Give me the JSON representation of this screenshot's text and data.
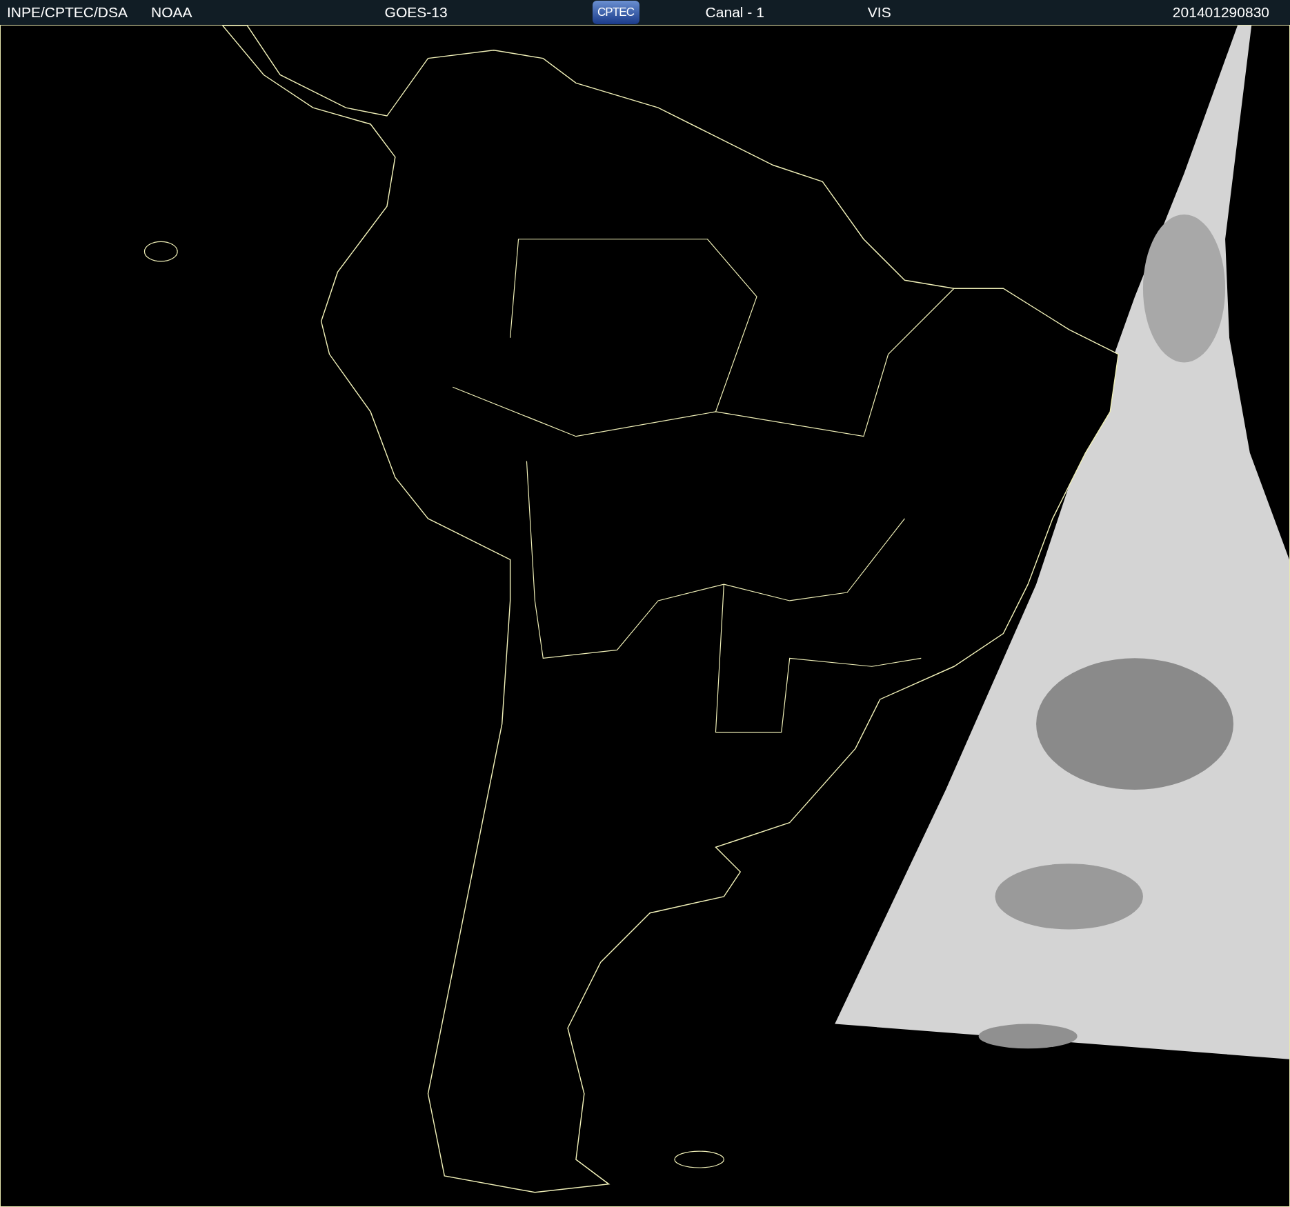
{
  "header": {
    "agency": "INPE/CPTEC/DSA",
    "source": "NOAA",
    "satellite": "GOES-13",
    "logo": "CPTEC",
    "channel": "Canal - 1",
    "band": "VIS",
    "timestamp": "201401290830"
  }
}
